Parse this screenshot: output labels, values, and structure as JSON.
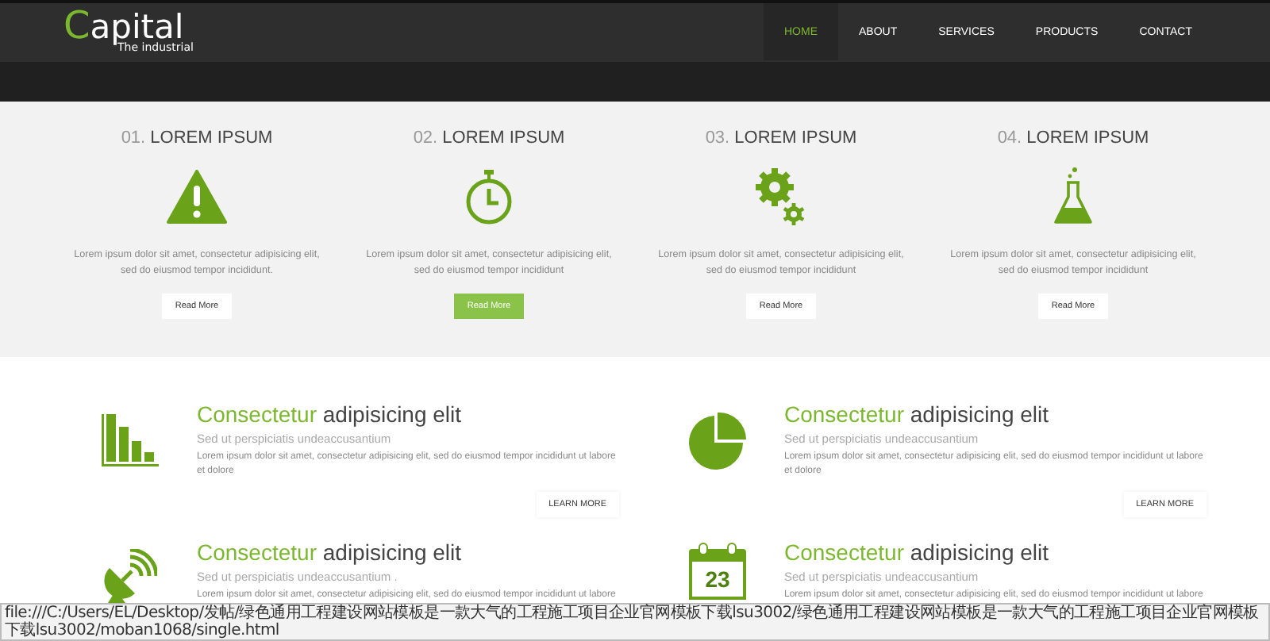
{
  "header": {
    "logo": {
      "initial": "C",
      "rest": "apital",
      "tagline": "The industrial"
    },
    "nav": [
      {
        "label": "HOME",
        "selected": true
      },
      {
        "label": "ABOUT",
        "selected": false
      },
      {
        "label": "SERVICES",
        "selected": false
      },
      {
        "label": "PRODUCTS",
        "selected": false
      },
      {
        "label": "CONTACT",
        "selected": false
      }
    ]
  },
  "features": [
    {
      "number": "01.",
      "title": "LOREM IPSUM",
      "text": "Lorem ipsum dolor sit amet, consectetur adipisicing elit, sed do eiusmod tempor incididunt.",
      "button": "Read More",
      "selected": false
    },
    {
      "number": "02.",
      "title": "LOREM IPSUM",
      "text": "Lorem ipsum dolor sit amet, consectetur adipisicing elit, sed do eiusmod tempor incididunt",
      "button": "Read More",
      "selected": true
    },
    {
      "number": "03.",
      "title": "LOREM IPSUM",
      "text": "Lorem ipsum dolor sit amet, consectetur adipisicing elit, sed do eiusmod tempor incididunt",
      "button": "Read More",
      "selected": false
    },
    {
      "number": "04.",
      "title": "LOREM IPSUM",
      "text": "Lorem ipsum dolor sit amet, consectetur adipisicing elit, sed do eiusmod tempor incididunt",
      "button": "Read More",
      "selected": false
    }
  ],
  "services": [
    {
      "title_highlight": "Consectetur",
      "title_rest": "adipisicing elit",
      "subtitle": "Sed ut perspiciatis undeaccusantium",
      "text": "Lorem ipsum dolor sit amet, consectetur adipisicing elit, sed do eiusmod tempor incididunt ut labore et dolore",
      "button": "LEARN MORE"
    },
    {
      "title_highlight": "Consectetur",
      "title_rest": "adipisicing elit",
      "subtitle": "Sed ut perspiciatis undeaccusantium",
      "text": "Lorem ipsum dolor sit amet, consectetur adipisicing elit, sed do eiusmod tempor incididunt ut labore et dolore",
      "button": "LEARN MORE"
    },
    {
      "title_highlight": "Consectetur",
      "title_rest": "adipisicing elit",
      "subtitle": "Sed ut perspiciatis undeaccusantium .",
      "text": "Lorem ipsum dolor sit amet, consectetur adipisicing elit, sed do eiusmod tempor incididunt ut labore"
    },
    {
      "icon_text": "23",
      "title_highlight": "Consectetur",
      "title_rest": "adipisicing elit",
      "subtitle": "Sed ut perspiciatis undeaccusantium",
      "text": "Lorem ipsum dolor sit amet, consectetur adipisicing elit, sed do eiusmod tempor incididunt ut labore"
    }
  ],
  "status_bar": "file:///C:/Users/EL/Desktop/发帖/绿色通用工程建设网站模板是一款大气的工程施工项目企业官网模板下载lsu3002/绿色通用工程建设网站模板是一款大气的工程施工项目企业官网模板下载lsu3002/moban1068/single.html"
}
